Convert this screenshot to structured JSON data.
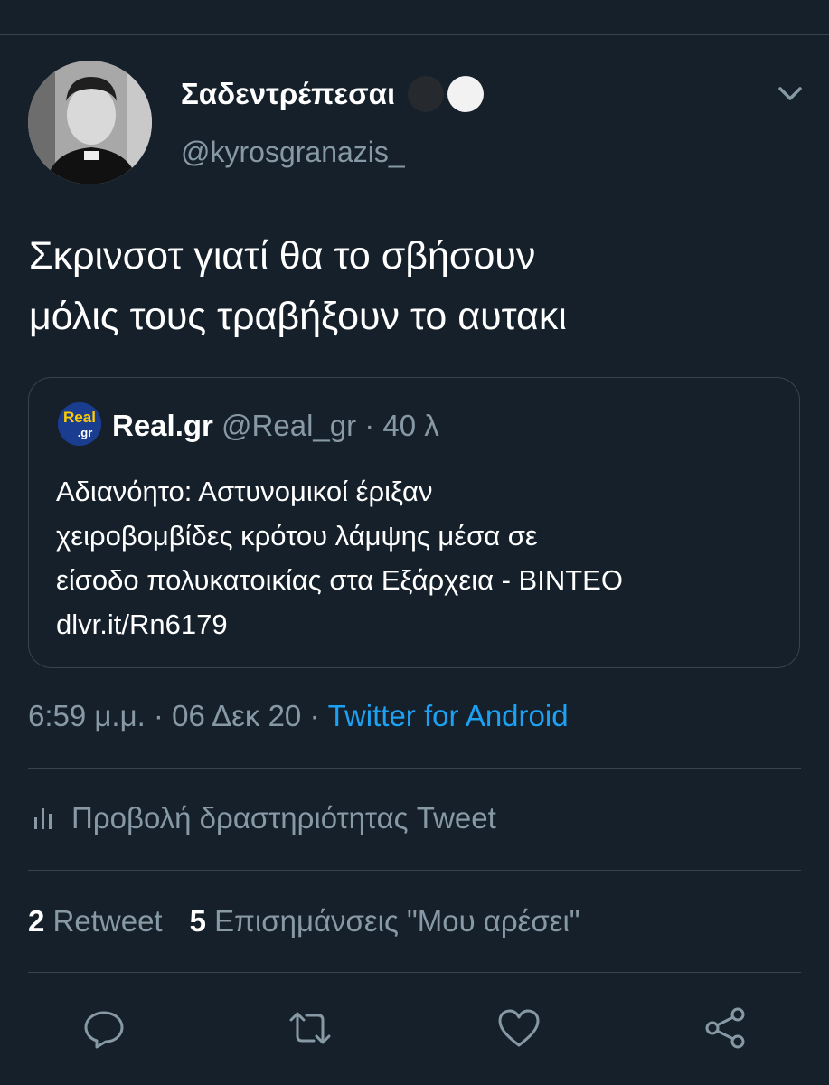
{
  "tweet": {
    "display_name": "Σαδεντρέπεσαι",
    "handle": "@kyrosgranazis_",
    "text_line1": "Σκρινσοτ γιατί θα το σβήσουν",
    "text_line2": "μόλις τους τραβήξουν το αυτακι",
    "timestamp": "6:59 μ.μ. · 06 Δεκ 20 · ",
    "source": "Twitter for Android"
  },
  "quoted": {
    "logo_text_top": "Real",
    "logo_text_bottom": ".gr",
    "name": "Real.gr",
    "handle_time": " @Real_gr · 40 λ",
    "line1": "Αδιανόητο: Αστυνομικοί έριξαν",
    "line2": "χειροβομβίδες κρότου λάμψης μέσα σε",
    "line3": "είσοδο πολυκατοικίας στα Εξάρχεια - ΒΙΝΤΕΟ",
    "line4": "dlvr.it/Rn6179"
  },
  "activity": {
    "label": "Προβολή δραστηριότητας Tweet"
  },
  "stats": {
    "retweet_count": "2",
    "retweet_label": " Retweet",
    "like_count": "5",
    "like_label": " Επισημάνσεις \"Μου αρέσει\""
  },
  "icons": {
    "caret": "chevron-down-icon",
    "activity": "bar-chart-icon",
    "reply": "reply-icon",
    "retweet": "retweet-icon",
    "like": "heart-icon",
    "share": "share-icon"
  },
  "colors": {
    "background": "#15202b",
    "divider": "#38444d",
    "secondary_text": "#8899a6",
    "link": "#1da1f2"
  }
}
